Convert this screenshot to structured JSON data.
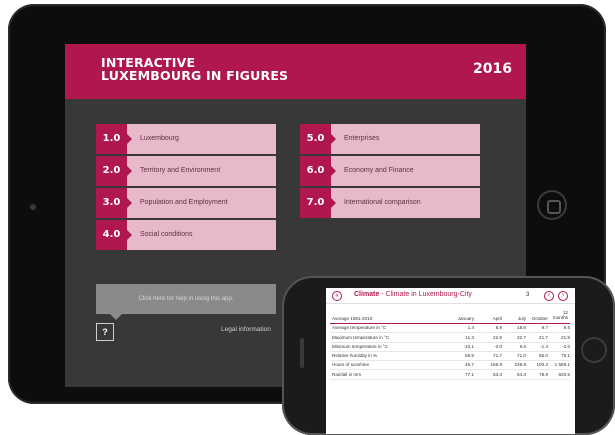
{
  "tablet": {
    "title_line1": "INTERACTIVE",
    "title_line2": "LUXEMBOURG IN FIGURES",
    "year": "2016",
    "menu": [
      {
        "num": "1.0",
        "label": "Luxembourg"
      },
      {
        "num": "2.0",
        "label": "Territory and Environment"
      },
      {
        "num": "3.0",
        "label": "Population and Employment"
      },
      {
        "num": "4.0",
        "label": "Social conditions"
      },
      {
        "num": "5.0",
        "label": "Enterprises"
      },
      {
        "num": "6.0",
        "label": "Economy and Finance"
      },
      {
        "num": "7.0",
        "label": "International comparison"
      }
    ],
    "help_text": "Click here for help in using this app.",
    "help_button": "?",
    "legal": "Legal information"
  },
  "phone": {
    "back": "«",
    "title_bold": "Climate",
    "title_rest": " - Climate in Luxembourg-City",
    "page": "3",
    "prev": "‹",
    "next": "›",
    "table": {
      "header_label": "Average 1981-2010",
      "columns": [
        "January",
        "April",
        "July",
        "October"
      ],
      "last_col_line1": "12",
      "last_col_line2": "months",
      "rows": [
        {
          "label": "Average temperature in °C",
          "values": [
            "1.4",
            "8.9",
            "18.6",
            "9.7",
            "9.6"
          ]
        },
        {
          "label": "Maximum temperature in °C",
          "values": [
            "11.3",
            "22.9",
            "32.7",
            "21.7",
            "21.9"
          ]
        },
        {
          "label": "Minimum temperature in °C",
          "values": [
            "-10.1",
            "-3.0",
            "6.6",
            "-1.4",
            "-2.0"
          ]
        },
        {
          "label": "Relative humidity in %",
          "values": [
            "86.9",
            "71.7",
            "71.0",
            "85.0",
            "79.1"
          ]
        },
        {
          "label": "Hours of sunshine",
          "values": [
            "45.7",
            "166.9",
            "239.8",
            "100.2",
            "1 569.1"
          ]
        },
        {
          "label": "Rainfall in mm",
          "values": [
            "77.1",
            "53.3",
            "64.3",
            "78.9",
            "820.6"
          ]
        }
      ]
    }
  },
  "colors": {
    "brand": "#b0174e",
    "menu_bg": "#e8b9cb",
    "screen_bg": "#383838"
  }
}
